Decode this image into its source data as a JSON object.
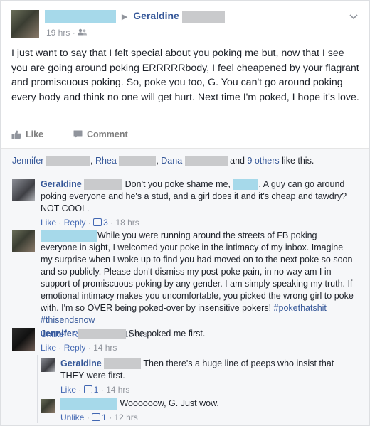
{
  "post": {
    "recipient": "Geraldine",
    "time": "19 hrs",
    "privacy_dot": "·",
    "text": "I just want to say that I felt special about you poking me but, now that I see you are going around poking ERRRRRbody, I feel cheapened by your flagrant and promiscuous poking. So, poke you too, G. You can't go around poking every body and think no one will get hurt. Next time I'm poked, I hope it's love.",
    "like_label": "Like",
    "comment_label": "Comment"
  },
  "likes": {
    "name1": "Jennifer",
    "name2": "Rhea",
    "name3": "Dana",
    "comma": ",",
    "and": "and",
    "others": "9 others",
    "suffix": "like this."
  },
  "comments": [
    {
      "author": "Geraldine",
      "text_a": "Don't you poke shame me,",
      "text_b": ". A guy can go around poking everyone and he's a stud, and a girl does it and it's cheap and tawdry? NOT COOL.",
      "action": "Like",
      "reply": "Reply",
      "likes": "3",
      "time": "18 hrs"
    },
    {
      "author": "",
      "text": "While you were running around the streets of FB poking everyone in sight, I welcomed your poke in the intimacy of my inbox. Imagine my surprise when I woke up to find you had moved on to the next poke so soon and so publicly. Please don't dismiss my post-poke pain, in no way am I in support of promiscuous poking by any gender. I am simply speaking my truth. If emotional intimacy makes you uncomfortable, you picked the wrong girl to poke with. I'm so OVER being poked-over by insensitive pokers!",
      "hashtag1": "#pokethatshit",
      "hashtag2": "#thisendsnow",
      "action": "Unlike",
      "reply": "Reply",
      "likes": "4",
      "time": "18 hrs"
    },
    {
      "author": "Jennifer",
      "text": "She poked me first.",
      "action": "Like",
      "reply": "Reply",
      "time": "14 hrs"
    }
  ],
  "replies": [
    {
      "author": "Geraldine",
      "text": "Then there's a huge line of peeps who insist that THEY were first.",
      "action": "Like",
      "likes": "1",
      "time": "14 hrs"
    },
    {
      "author": "",
      "text": "Woooooow, G. Just wow.",
      "action": "Unlike",
      "likes": "1",
      "time": "12 hrs"
    }
  ],
  "separator": "·",
  "colors": {
    "link": "#365899",
    "redact_blue": "#a6d9ea",
    "redact_gray": "#c9cacc"
  },
  "icons": [
    "chevron-down-icon",
    "friends-privacy-icon",
    "like-thumb-icon",
    "comment-bubble-icon"
  ]
}
